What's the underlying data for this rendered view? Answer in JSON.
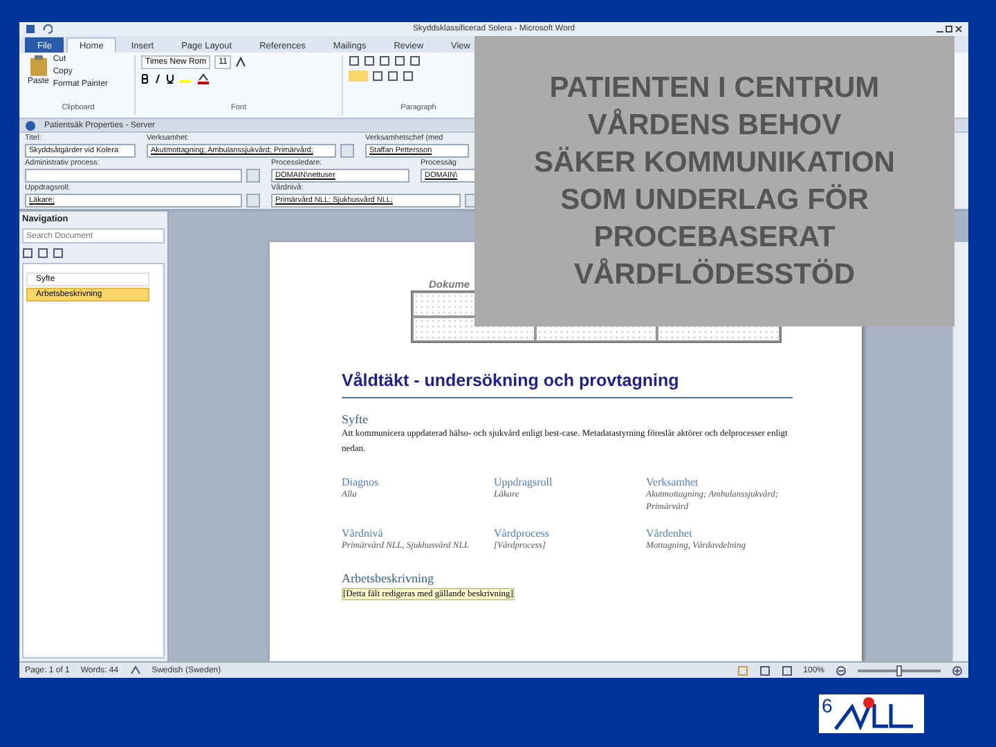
{
  "window": {
    "title": "Skyddsklassificerad Solera - Microsoft Word"
  },
  "ribbon_tabs": [
    {
      "label": "File",
      "selected": false,
      "kind": "file"
    },
    {
      "label": "Home",
      "selected": true,
      "kind": "tab"
    },
    {
      "label": "Insert",
      "selected": false,
      "kind": "tab"
    },
    {
      "label": "Page Layout",
      "selected": false,
      "kind": "tab"
    },
    {
      "label": "References",
      "selected": false,
      "kind": "tab"
    },
    {
      "label": "Mailings",
      "selected": false,
      "kind": "tab"
    },
    {
      "label": "Review",
      "selected": false,
      "kind": "tab"
    },
    {
      "label": "View",
      "selected": false,
      "kind": "tab"
    }
  ],
  "clipboard": {
    "paste": "Paste",
    "cut": "Cut",
    "copy": "Copy",
    "format_painter": "Format Painter",
    "label": "Clipboard"
  },
  "font": {
    "name": "Times New Rom",
    "size": "11",
    "label": "Font"
  },
  "paragraph": {
    "label": "Paragraph"
  },
  "properties_bar": {
    "title": "Patientsäk Properties - Server"
  },
  "property_rows": [
    [
      {
        "label": "Titel:",
        "value": "Skyddsåtgärder vid Kolera",
        "kind": "text"
      },
      {
        "label": "Verksamhet:",
        "value": "Akutmottagning; Ambulanssjukvård; Primärvård;",
        "kind": "lookup"
      },
      {
        "label": "Verksamhetschef (med",
        "value": "Staffan Pettersson",
        "kind": "person"
      }
    ],
    [
      {
        "label": "Administrativ process:",
        "kind": "lookup"
      },
      {
        "label": "Processledare:",
        "value": "DOMAIN\\nettuser",
        "kind": "person"
      },
      {
        "label": "Processäg",
        "value": "DOMAIN\\",
        "kind": "person"
      }
    ],
    [
      {
        "label": "Uppdragsroll:",
        "value": "Läkare;",
        "kind": "lookup"
      },
      {
        "label": "Vårdnivå:",
        "value": "Primärvård NLL; Sjukhusvård NLL;",
        "kind": "lookup"
      }
    ]
  ],
  "navigation": {
    "title": "Navigation",
    "search": {
      "placeholder": "Search Document"
    },
    "items": [
      {
        "label": "Syfte",
        "selected": false
      },
      {
        "label": "Arbetsbeskrivning",
        "selected": true
      }
    ]
  },
  "document": {
    "header": "Dokume",
    "title": "Våldtäkt - undersökning och provtagning",
    "purpose_heading": "Syfte",
    "purpose_text": "Att kommunicera uppdaterad hälso- och sjukvård enligt best-case. Metadatastyrning föreslår aktörer och delprocesser enligt nedan.",
    "metadata": [
      {
        "label": "Diagnos",
        "value": "Alla"
      },
      {
        "label": "Uppdragsroll",
        "value": "Läkare"
      },
      {
        "label": "Verksamhet",
        "value": "Akutmottagning; Ambulanssjukvård; Primärvård"
      },
      {
        "label": "Vårdnivå",
        "value": "Primärvård NLL, Sjukhusvård NLL"
      },
      {
        "label": "Vårdprocess",
        "value": "[Vårdprocess]"
      },
      {
        "label": "Vårdenhet",
        "value": "Mottagning, Vårdavdelning"
      }
    ],
    "work_heading": "Arbetsbeskrivning",
    "work_text": "[Detta fält redigeras med gällande beskrivning]"
  },
  "status_bar": {
    "page": "Page: 1 of 1",
    "words": "Words: 44",
    "language": "Swedish (Sweden)",
    "zoom": "100%",
    "zoom_level": {
      "level": 0.5
    }
  },
  "overlay": {
    "lines": [
      "PATIENTEN I CENTRUM",
      "VÅRDENS BEHOV",
      "SÄKER KOMMUNIKATION",
      "SOM UNDERLAG FÖR",
      "PROCEBASERAT",
      "VÅRDFLÖDESSTÖD"
    ]
  },
  "slide_number": "6"
}
